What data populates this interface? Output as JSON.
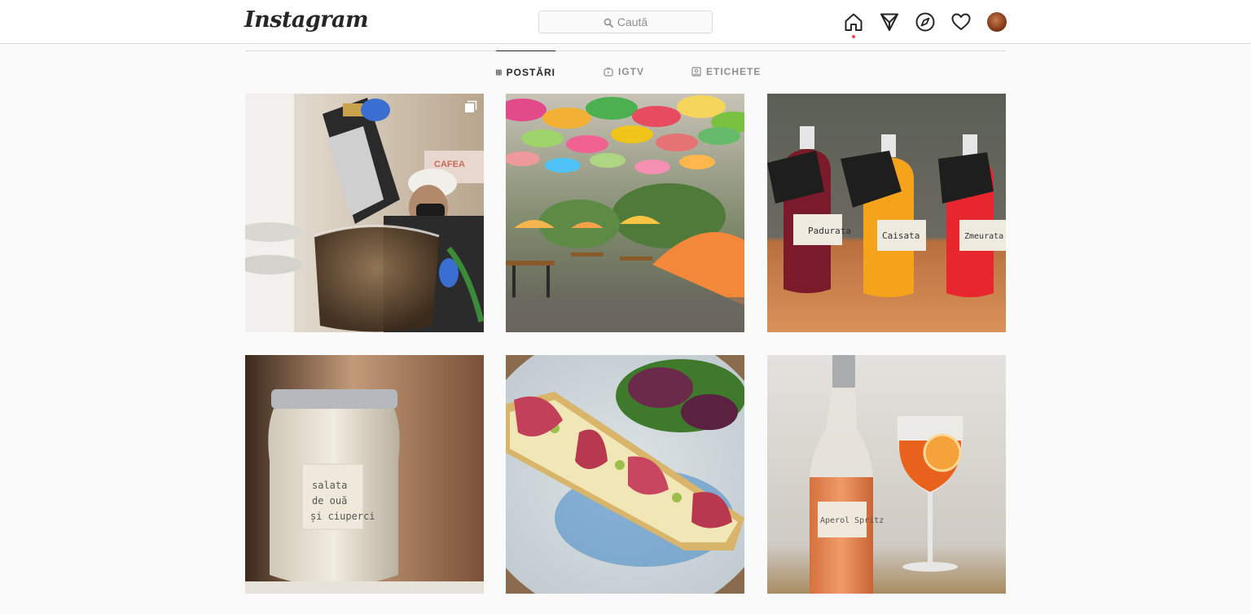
{
  "header": {
    "logo": "Instagram",
    "search_placeholder": "Caută",
    "icons": [
      "home-icon",
      "direct-messages-icon",
      "explore-icon",
      "activity-heart-icon"
    ]
  },
  "tabs": [
    {
      "label": "POSTĂRI",
      "icon": "grid-icon",
      "active": true
    },
    {
      "label": "IGTV",
      "icon": "igtv-icon",
      "active": false
    },
    {
      "label": "ETICHETE",
      "icon": "tagged-icon",
      "active": false
    }
  ],
  "posts": [
    {
      "subject": "coffee-beans-pour",
      "multiple": true,
      "labels": []
    },
    {
      "subject": "umbrella-terrace",
      "multiple": false,
      "labels": []
    },
    {
      "subject": "three-juice-bottles",
      "multiple": false,
      "labels": [
        "Padurata",
        "Caisata",
        "Zmeurata"
      ]
    },
    {
      "subject": "egg-salad-jar",
      "multiple": false,
      "labels": [
        "salata",
        "de ouă",
        "și ciuperci"
      ]
    },
    {
      "subject": "prosciutto-toast",
      "multiple": false,
      "labels": []
    },
    {
      "subject": "aperol-spritz",
      "multiple": false,
      "labels": [
        "Aperol Spritz"
      ]
    }
  ],
  "colors": {
    "accent_dot": "#ed4956",
    "border": "#dbdbdb",
    "text": "#262626",
    "muted": "#8e8e8e"
  }
}
